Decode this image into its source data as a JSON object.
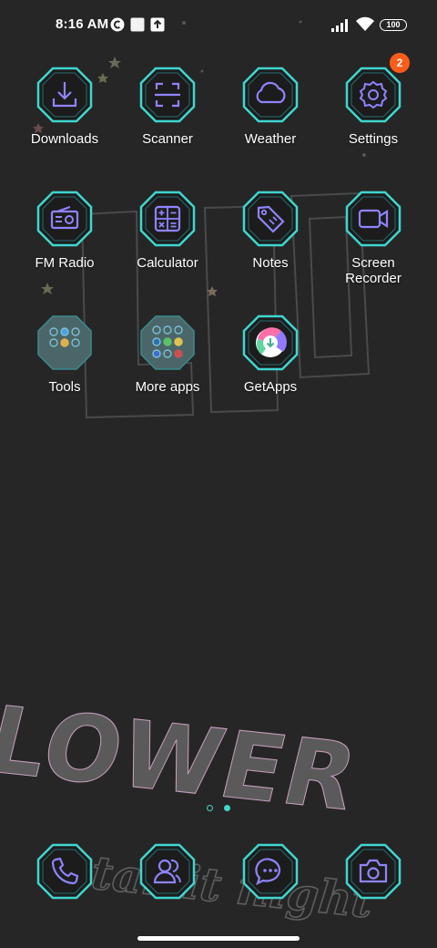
{
  "status_bar": {
    "time": "8:16 AM",
    "battery": "100",
    "icons": [
      "notification-c-icon",
      "notification-square-icon",
      "upload-icon",
      "signal-icon",
      "wifi-icon",
      "battery-icon"
    ]
  },
  "badges": {
    "settings": "2"
  },
  "apps": [
    {
      "label": "Downloads",
      "icon": "download-icon"
    },
    {
      "label": "Scanner",
      "icon": "scanner-icon"
    },
    {
      "label": "Weather",
      "icon": "cloud-icon"
    },
    {
      "label": "Settings",
      "icon": "gear-icon"
    },
    {
      "label": "FM Radio",
      "icon": "radio-icon"
    },
    {
      "label": "Calculator",
      "icon": "calculator-icon"
    },
    {
      "label": "Notes",
      "icon": "tag-icon"
    },
    {
      "label": "Screen\nRecorder",
      "icon": "video-camera-icon"
    },
    {
      "label": "Tools",
      "icon": "folder-icon"
    },
    {
      "label": "More apps",
      "icon": "folder-icon"
    },
    {
      "label": "GetApps",
      "icon": "getapps-icon"
    }
  ],
  "dock": [
    {
      "icon": "phone-icon"
    },
    {
      "icon": "contacts-icon"
    },
    {
      "icon": "messages-icon"
    },
    {
      "icon": "camera-icon"
    }
  ],
  "wallpaper": {
    "big_text": "FLOWER",
    "script_text": "starlit night"
  },
  "colors": {
    "accent": "#3fd6cf",
    "icon_line": "#8f84ff",
    "badge": "#ff5c1a",
    "background": "#262626"
  }
}
